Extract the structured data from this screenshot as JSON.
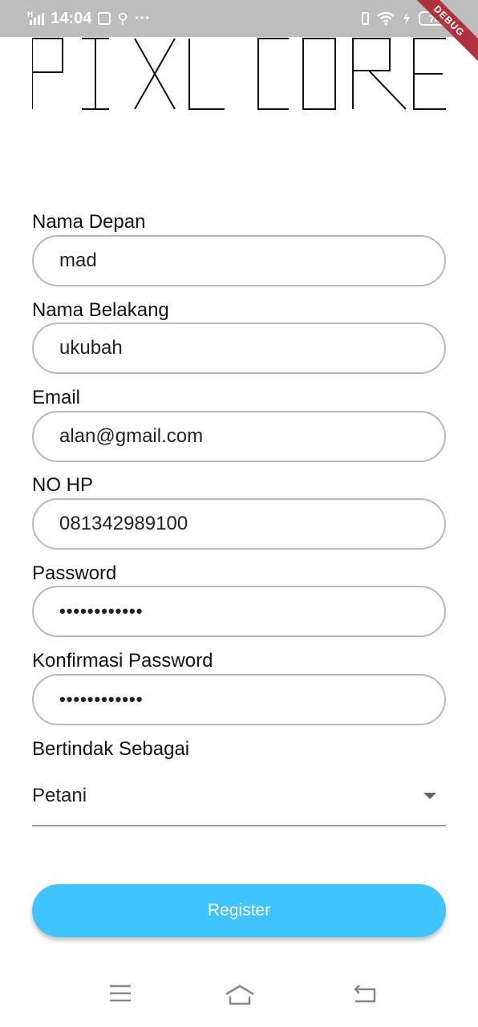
{
  "status_bar": {
    "signal_label": "H",
    "time": "14:04",
    "notif_dots": "···",
    "battery": "74"
  },
  "debug_banner": "DEBUG",
  "logo": {
    "text": "PIXL CORE"
  },
  "form": {
    "first_name": {
      "label": "Nama Depan",
      "value": "mad"
    },
    "last_name": {
      "label": "Nama Belakang",
      "value": "ukubah"
    },
    "email": {
      "label": "Email",
      "value": "alan@gmail.com"
    },
    "phone": {
      "label": "NO HP",
      "value": "081342989100"
    },
    "password": {
      "label": "Password",
      "value": "••••••••••••"
    },
    "confirm_password": {
      "label": "Konfirmasi Password",
      "value": "••••••••••••"
    },
    "role": {
      "label": "Bertindak Sebagai",
      "value": "Petani"
    },
    "register_label": "Register"
  },
  "colors": {
    "accent": "#40c4ff",
    "status_bar": "#bdbdbd",
    "debug": "#b0323f"
  },
  "nav": {
    "icons": [
      "menu-icon",
      "home-icon",
      "back-icon"
    ]
  }
}
